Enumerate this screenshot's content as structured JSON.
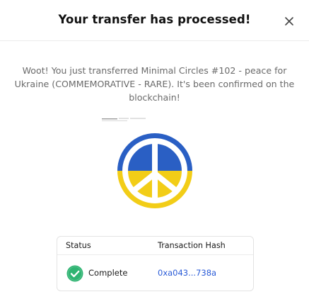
{
  "modal": {
    "title": "Your transfer has processed!",
    "close_icon": "close-icon",
    "message": "Woot! You just transferred Minimal Circles #102 - peace for Ukraine (COMMEMORATIVE - RARE). It's been confirmed on the blockchain!",
    "nft_image": "peace-symbol-ukraine-flag"
  },
  "transaction": {
    "headers": {
      "status": "Status",
      "hash": "Transaction Hash"
    },
    "status_icon": "check-circle-icon",
    "status_value": "Complete",
    "hash_value": "0xa043...738a"
  },
  "colors": {
    "ukraine_blue": "#2a5fc4",
    "ukraine_yellow": "#f2cd17",
    "success_green": "#2fb472",
    "link_blue": "#2a5bd7"
  }
}
